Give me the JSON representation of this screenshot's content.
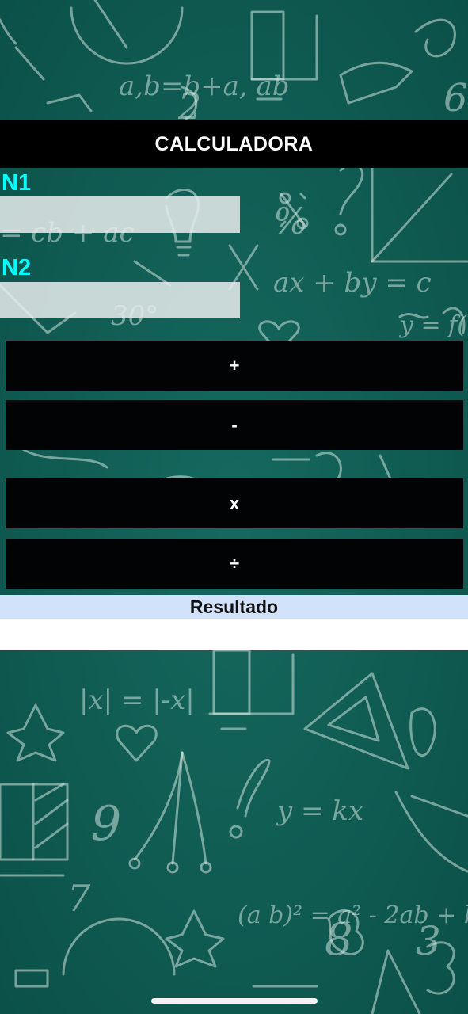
{
  "app": {
    "title": "CALCULADORA"
  },
  "inputs": {
    "n1": {
      "label": "N1",
      "value": "",
      "placeholder": ""
    },
    "n2": {
      "label": "N2",
      "value": "",
      "placeholder": ""
    }
  },
  "operations": [
    {
      "label": "+"
    },
    {
      "label": "-"
    },
    {
      "label": "x"
    },
    {
      "label": "÷"
    }
  ],
  "result": {
    "label": "Resultado",
    "value": ""
  },
  "colors": {
    "chalkboard": "#0f5f56",
    "title_bar": "#000000",
    "label_accent": "#00ffff",
    "button_bg": "#020304",
    "result_label_bg": "#d3e2fb",
    "result_box_bg": "#ffffff"
  },
  "icons": {
    "background": "chalkboard-math-doodles"
  }
}
